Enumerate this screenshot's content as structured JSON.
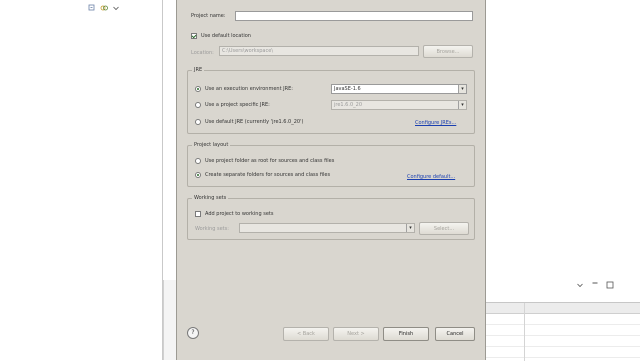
{
  "ide": {
    "left_toolbar_icons": [
      "collapse-all-icon",
      "link-editor-icon",
      "view-menu-icon"
    ],
    "right_toolbar_icons": [
      "minimize-icon",
      "maximize-icon",
      "close-icon"
    ]
  },
  "dialog": {
    "project_name_label": "Project name:",
    "project_name_value": "",
    "use_default_location_label": "Use default location",
    "use_default_location_checked": true,
    "location_label": "Location:",
    "location_value": "C:\\Users\\workspace\\",
    "browse_label": "Browse...",
    "jre_group_title": "JRE",
    "jre_options": [
      {
        "label": "Use an execution environment JRE:",
        "selected": true,
        "value": "JavaSE-1.6"
      },
      {
        "label": "Use a project specific JRE:",
        "selected": false,
        "value": "jre1.6.0_20"
      },
      {
        "label": "Use default JRE (currently 'jre1.6.0_20')",
        "selected": false
      }
    ],
    "configure_jres_label": "Configure JREs...",
    "layout_group_title": "Project layout",
    "layout_options": [
      {
        "label": "Use project folder as root for sources and class files",
        "selected": false
      },
      {
        "label": "Create separate folders for sources and class files",
        "selected": true
      }
    ],
    "configure_default_label": "Configure default...",
    "working_sets_group_title": "Working sets",
    "add_to_working_sets_label": "Add project to working sets",
    "working_sets_label": "Working sets:",
    "working_sets_value": "",
    "select_label": "Select...",
    "help_symbol": "?",
    "buttons": {
      "back": "< Back",
      "next": "Next >",
      "finish": "Finish",
      "cancel": "Cancel"
    }
  }
}
